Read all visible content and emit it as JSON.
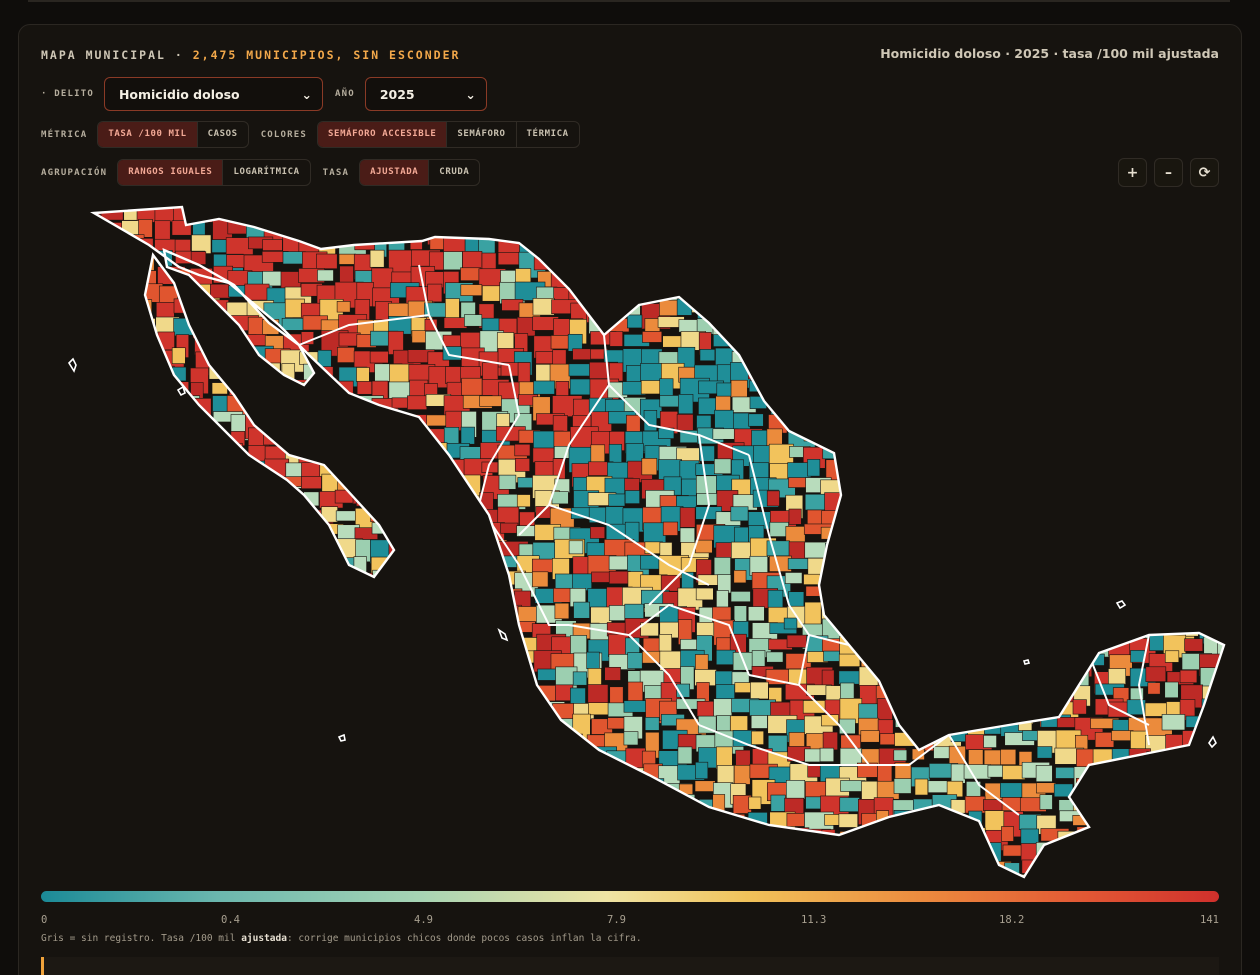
{
  "header": {
    "title_prefix": "MAPA MUNICIPAL ·",
    "title_highlight": "2,475 MUNICIPIOS, SIN ESCONDER",
    "subtitle": "Homicidio doloso · 2025 · tasa /100 mil ajustada"
  },
  "filters": {
    "delito_label": "· DELITO",
    "delito_value": "Homicidio doloso",
    "anio_label": "AÑO",
    "anio_value": "2025"
  },
  "metrica": {
    "label": "MÉTRICA",
    "options": [
      "TASA /100 MIL",
      "CASOS"
    ],
    "selected": "TASA /100 MIL"
  },
  "colores": {
    "label": "COLORES",
    "options": [
      "SEMÁFORO ACCESIBLE",
      "SEMÁFORO",
      "TÉRMICA"
    ],
    "selected": "SEMÁFORO ACCESIBLE"
  },
  "agrupacion": {
    "label": "AGRUPACIÓN",
    "options": [
      "RANGOS IGUALES",
      "LOGARÍTMICA"
    ],
    "selected": "RANGOS IGUALES"
  },
  "tasa": {
    "label": "TASA",
    "options": [
      "AJUSTADA",
      "CRUDA"
    ],
    "selected": "AJUSTADA"
  },
  "zoom": {
    "in_icon": "+",
    "out_icon": "–",
    "reset_icon": "⟳"
  },
  "legend": {
    "colors": [
      "#1b8a97",
      "#a6d4b4",
      "#efe4a4",
      "#f1c25a",
      "#ec8a3e",
      "#e35a35",
      "#d0302c"
    ],
    "ticks": [
      "0",
      "0.4",
      "4.9",
      "7.9",
      "11.3",
      "18.2",
      "141"
    ],
    "note_prefix": "Gris = sin registro. Tasa /100 mil ",
    "note_bold": "ajustada",
    "note_suffix": ": corrige municipios chicos donde pocos casos inflan la cifra."
  },
  "palette": [
    "#1f8e98",
    "#3aa2a2",
    "#9ccfb0",
    "#b8dcbc",
    "#f0d98a",
    "#f2c35c",
    "#eb8b3c",
    "#e0552f",
    "#cf342c",
    "#bd2a26"
  ]
}
